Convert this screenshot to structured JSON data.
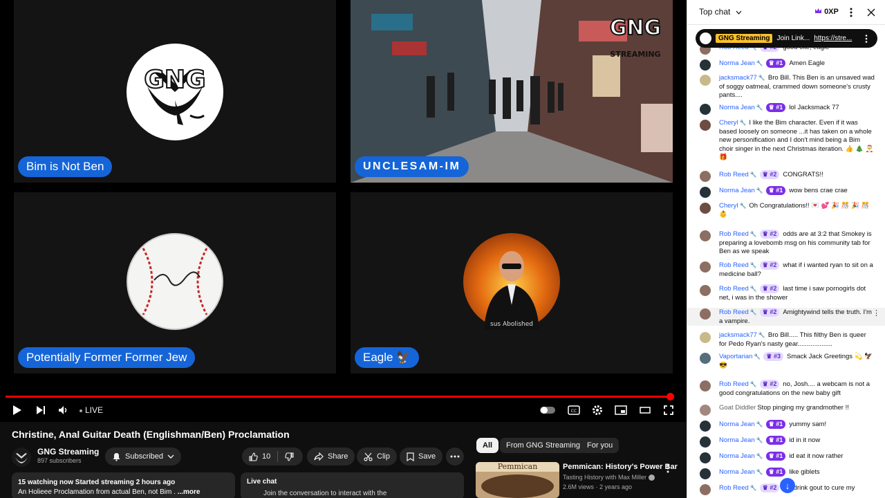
{
  "player": {
    "tiles": [
      {
        "name": "Bim is Not Ben"
      },
      {
        "name": "UNCLESAM-IM"
      },
      {
        "name": "Potentially Former Former Jew"
      },
      {
        "name": "Eagle 🦅"
      }
    ],
    "watermark": "GNG",
    "watermark_sub": "STREAMING",
    "logo_text": "GNG",
    "caption_fragment": "sus Abolished",
    "live_label": "LIVE",
    "progress": 0.98
  },
  "video": {
    "title": "Christine, Anal Guitar Death (Englishman/Ben) Proclamation",
    "channel": "GNG Streaming",
    "subscribers": "897 subscribers",
    "subscribed_label": "Subscribed",
    "like_count": "10",
    "share_label": "Share",
    "clip_label": "Clip",
    "save_label": "Save",
    "desc_stats": "15 watching now  Started streaming 2 hours ago",
    "desc_text": "An Holieee Proclamation from actual Ben, not Bim . ",
    "desc_more": "...more",
    "livechat_title": "Live chat",
    "livechat_text": "Join the conversation to interact with the"
  },
  "recs": {
    "chips": [
      "All",
      "From GNG Streaming",
      "For you"
    ],
    "item": {
      "title": "Pemmican: History's Power Bar",
      "channel": "Tasting History with Max Miller",
      "meta": "2.6M views · 2 years ago",
      "thumb_text": "Pemmican"
    }
  },
  "chat": {
    "header": "Top chat",
    "xp": "0XP",
    "pinned_author": "GNG Streaming",
    "pinned_text": "Join Link... ",
    "pinned_link": "https://stre...",
    "messages": [
      {
        "author": "Rob Reed",
        "rank": "#2",
        "text": "good cite, eagle"
      },
      {
        "author": "Norma Jean",
        "rank": "#1",
        "solid": true,
        "text": "Amen Eagle"
      },
      {
        "author": "jacksmack77",
        "rank": "",
        "text": "Bro Bill. This Ben is an unsaved wad of soggy oatmeal, crammed down someone's crusty pants...."
      },
      {
        "author": "Norma Jean",
        "rank": "#1",
        "solid": true,
        "text": "lol Jacksmack 77"
      },
      {
        "author": "Cheryl",
        "rank": "",
        "text": "I like the Bim character. Even if it was based loosely on someone ...it has taken on a whole new personification and I don't mind being a Bim choir singer in the next Christmas iteration. 👍 🎄 🎅 🎁"
      },
      {
        "author": "Rob Reed",
        "rank": "#2",
        "text": "CONGRATS!!"
      },
      {
        "author": "Norma Jean",
        "rank": "#1",
        "solid": true,
        "text": "wow bens crae crae"
      },
      {
        "author": "Cheryl",
        "rank": "",
        "text": "Oh Congratulations!! 💌 💕 🎉 🎊 🎉 🎊 👶"
      },
      {
        "author": "Rob Reed",
        "rank": "#2",
        "text": "odds are at 3:2 that Smokey is preparing a lovebomb msg on his community tab for Ben as we speak"
      },
      {
        "author": "Rob Reed",
        "rank": "#2",
        "text": "what if i wanted ryan to sit on a medicine ball?"
      },
      {
        "author": "Rob Reed",
        "rank": "#2",
        "text": "last time i saw pornogirls dot net, i was in the shower"
      },
      {
        "author": "Rob Reed",
        "rank": "#2",
        "text": "Amightywind tells the truth. I'm a vampire."
      },
      {
        "author": "jacksmack77",
        "rank": "",
        "text": "Bro Bill..... This filthy Ben is queer for Pedo Ryan's nasty gear..................."
      },
      {
        "author": "Vaportarian",
        "rank": "#3",
        "text": "Smack Jack Greetings 💫 🦅 😎"
      },
      {
        "author": "Rob Reed",
        "rank": "#2",
        "text": "no, Josh.... a webcam is not a good congratulations on the new baby gift"
      },
      {
        "author": "Goat Diddler",
        "rank": "",
        "plain": true,
        "text": "Stop pinging my grandmother !!"
      },
      {
        "author": "Norma Jean",
        "rank": "#1",
        "solid": true,
        "text": "yummy sam!"
      },
      {
        "author": "Norma Jean",
        "rank": "#1",
        "solid": true,
        "text": "id in it now"
      },
      {
        "author": "Norma Jean",
        "rank": "#1",
        "solid": true,
        "text": "id eat it now rather"
      },
      {
        "author": "Norma Jean",
        "rank": "#1",
        "solid": true,
        "text": "like giblets"
      },
      {
        "author": "Rob Reed",
        "rank": "#2",
        "text": "s. I drink gout to cure my"
      }
    ]
  }
}
